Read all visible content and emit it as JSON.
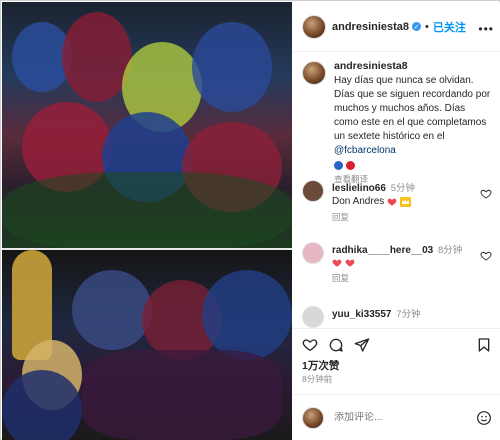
{
  "post": {
    "username": "andresiniesta8",
    "verified_mark": "✓",
    "dot": "•",
    "follow_label": "已关注",
    "more": "•••"
  },
  "caption": {
    "username": "andresiniesta8",
    "text_before_mention": "Hay días que nunca se olvidan. Días que se siguen recordando por muchos y muchos años. Días como este en el que completamos un sextete histórico en el ",
    "mention": "@fcbarcelona",
    "emoji_colors": [
      "#2a63c8",
      "#d81f2a"
    ],
    "see_translation": "查看翻译"
  },
  "comments": [
    {
      "username": "leslielino66",
      "time": "5分钟",
      "text": "Don Andres",
      "reply": "回复",
      "avatar_color": "#6b4a3a"
    },
    {
      "username": "radhika____here__03",
      "time": "8分钟",
      "text": "",
      "reply": "回复",
      "avatar_color": "#e7b8c4"
    },
    {
      "username": "yuu_ki33557",
      "time": "7分钟",
      "text": "",
      "reply": "",
      "avatar_color": "#d8d8d8"
    }
  ],
  "stats": {
    "likes": "1万次赞",
    "time_ago": "8分钟前"
  },
  "comment_bar": {
    "placeholder": "添加评论..."
  },
  "colors": {
    "link_blue": "#0095f6",
    "heart_red": "#ed4956",
    "muted": "#8e8e8e"
  }
}
